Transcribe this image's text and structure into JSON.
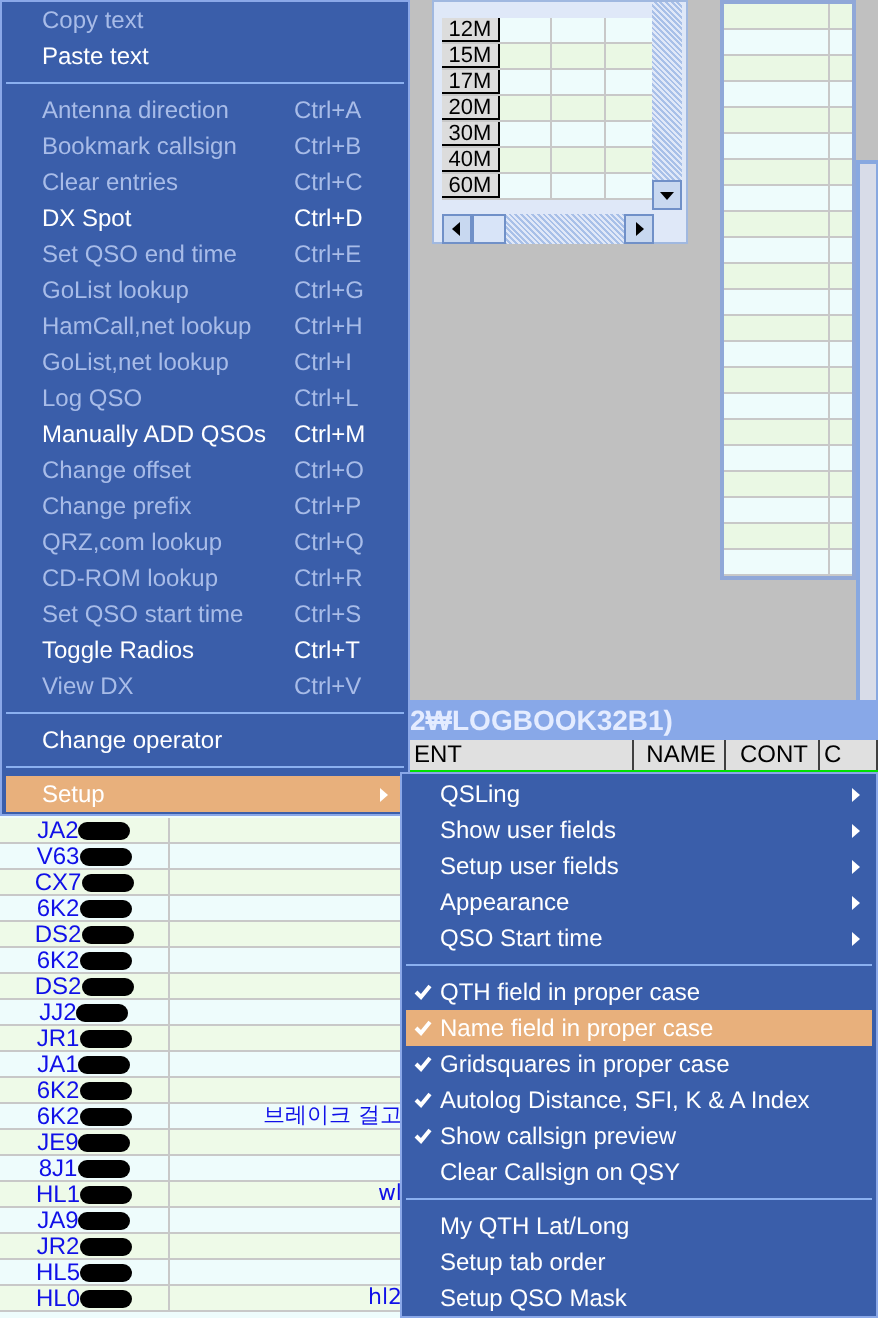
{
  "band_table": {
    "bands": [
      "12M",
      "15M",
      "17M",
      "20M",
      "30M",
      "40M",
      "60M"
    ]
  },
  "logbook": {
    "title": "2₩LOGBOOK32B1)",
    "columns": [
      "ENT",
      "NAME",
      "CONT",
      "C"
    ],
    "rows": [
      {
        "call": "JA2",
        "redacted": true
      },
      {
        "call": "V63",
        "redacted": true
      },
      {
        "call": "CX7",
        "redacted": true
      },
      {
        "call": "6K2",
        "redacted": true
      },
      {
        "call": "DS2",
        "redacted": true
      },
      {
        "call": "6K2",
        "redacted": true
      },
      {
        "call": "DS2",
        "redacted": true
      },
      {
        "call": "JJ2",
        "redacted": true
      },
      {
        "call": "JR1",
        "redacted": true
      },
      {
        "call": "JA1",
        "redacted": true
      },
      {
        "call": "6K2",
        "redacted": true
      },
      {
        "call": "6K2",
        "redacted": true,
        "comment": "브레이크 걸고"
      },
      {
        "call": "JE9",
        "redacted": true
      },
      {
        "call": "8J1",
        "redacted": true
      },
      {
        "call": "HL1",
        "redacted": true,
        "comment": "wl"
      },
      {
        "call": "JA9",
        "redacted": true
      },
      {
        "call": "JR2",
        "redacted": true
      },
      {
        "call": "HL5",
        "redacted": true
      },
      {
        "call": "HL0",
        "redacted": true,
        "comment": "hl2"
      }
    ]
  },
  "context_menu": {
    "items": [
      {
        "kind": "item",
        "label": "Copy text",
        "disabled": true,
        "selected": false
      },
      {
        "kind": "item",
        "label": "Paste text",
        "disabled": false,
        "selected": false
      },
      {
        "kind": "separator"
      },
      {
        "kind": "item",
        "label": "Antenna direction",
        "shortcut": "Ctrl+A",
        "disabled": true,
        "selected": false
      },
      {
        "kind": "item",
        "label": "Bookmark callsign",
        "shortcut": "Ctrl+B",
        "disabled": true,
        "selected": false
      },
      {
        "kind": "item",
        "label": "Clear entries",
        "shortcut": "Ctrl+C",
        "disabled": true,
        "selected": false
      },
      {
        "kind": "item",
        "label": "DX Spot",
        "shortcut": "Ctrl+D",
        "disabled": false,
        "selected": false
      },
      {
        "kind": "item",
        "label": "Set QSO end time",
        "shortcut": "Ctrl+E",
        "disabled": true,
        "selected": false
      },
      {
        "kind": "item",
        "label": "GoList lookup",
        "shortcut": "Ctrl+G",
        "disabled": true,
        "selected": false
      },
      {
        "kind": "item",
        "label": "HamCall,net lookup",
        "shortcut": "Ctrl+H",
        "disabled": true,
        "selected": false
      },
      {
        "kind": "item",
        "label": "GoList,net lookup",
        "shortcut": "Ctrl+I",
        "disabled": true,
        "selected": false
      },
      {
        "kind": "item",
        "label": "Log QSO",
        "shortcut": "Ctrl+L",
        "disabled": true,
        "selected": false
      },
      {
        "kind": "item",
        "label": "Manually ADD QSOs",
        "shortcut": "Ctrl+M",
        "disabled": false,
        "selected": false
      },
      {
        "kind": "item",
        "label": "Change offset",
        "shortcut": "Ctrl+O",
        "disabled": true,
        "selected": false
      },
      {
        "kind": "item",
        "label": "Change prefix",
        "shortcut": "Ctrl+P",
        "disabled": true,
        "selected": false
      },
      {
        "kind": "item",
        "label": "QRZ,com lookup",
        "shortcut": "Ctrl+Q",
        "disabled": true,
        "selected": false
      },
      {
        "kind": "item",
        "label": "CD-ROM lookup",
        "shortcut": "Ctrl+R",
        "disabled": true,
        "selected": false
      },
      {
        "kind": "item",
        "label": "Set QSO start time",
        "shortcut": "Ctrl+S",
        "disabled": true,
        "selected": false
      },
      {
        "kind": "item",
        "label": "Toggle Radios",
        "shortcut": "Ctrl+T",
        "disabled": false,
        "selected": false
      },
      {
        "kind": "item",
        "label": "View DX",
        "shortcut": "Ctrl+V",
        "disabled": true,
        "selected": false
      },
      {
        "kind": "separator"
      },
      {
        "kind": "item",
        "label": "Change operator",
        "disabled": false,
        "selected": false
      },
      {
        "kind": "separator"
      },
      {
        "kind": "item",
        "label": "Setup",
        "disabled": false,
        "selected": true,
        "submenu": true
      }
    ]
  },
  "setup_submenu": {
    "items": [
      {
        "kind": "item",
        "label": "QSLing",
        "submenu": true,
        "checked": false,
        "selected": false
      },
      {
        "kind": "item",
        "label": "Show user fields",
        "submenu": true,
        "checked": false,
        "selected": false
      },
      {
        "kind": "item",
        "label": "Setup user fields",
        "submenu": true,
        "checked": false,
        "selected": false
      },
      {
        "kind": "item",
        "label": "Appearance",
        "submenu": true,
        "checked": false,
        "selected": false
      },
      {
        "kind": "item",
        "label": "QSO Start time",
        "submenu": true,
        "checked": false,
        "selected": false
      },
      {
        "kind": "separator"
      },
      {
        "kind": "item",
        "label": "QTH field in proper case",
        "checked": true,
        "selected": false
      },
      {
        "kind": "item",
        "label": "Name field in proper case",
        "checked": true,
        "selected": true
      },
      {
        "kind": "item",
        "label": "Gridsquares in proper case",
        "checked": true,
        "selected": false
      },
      {
        "kind": "item",
        "label": "Autolog Distance, SFI, K & A Index",
        "checked": true,
        "selected": false
      },
      {
        "kind": "item",
        "label": "Show callsign preview",
        "checked": true,
        "selected": false
      },
      {
        "kind": "item",
        "label": "Clear Callsign on QSY",
        "checked": false,
        "selected": false
      },
      {
        "kind": "separator"
      },
      {
        "kind": "item",
        "label": "My QTH Lat/Long",
        "checked": false,
        "selected": false
      },
      {
        "kind": "item",
        "label": "Setup tab order",
        "checked": false,
        "selected": false
      },
      {
        "kind": "item",
        "label": "Setup QSO Mask",
        "checked": false,
        "selected": false
      }
    ]
  }
}
